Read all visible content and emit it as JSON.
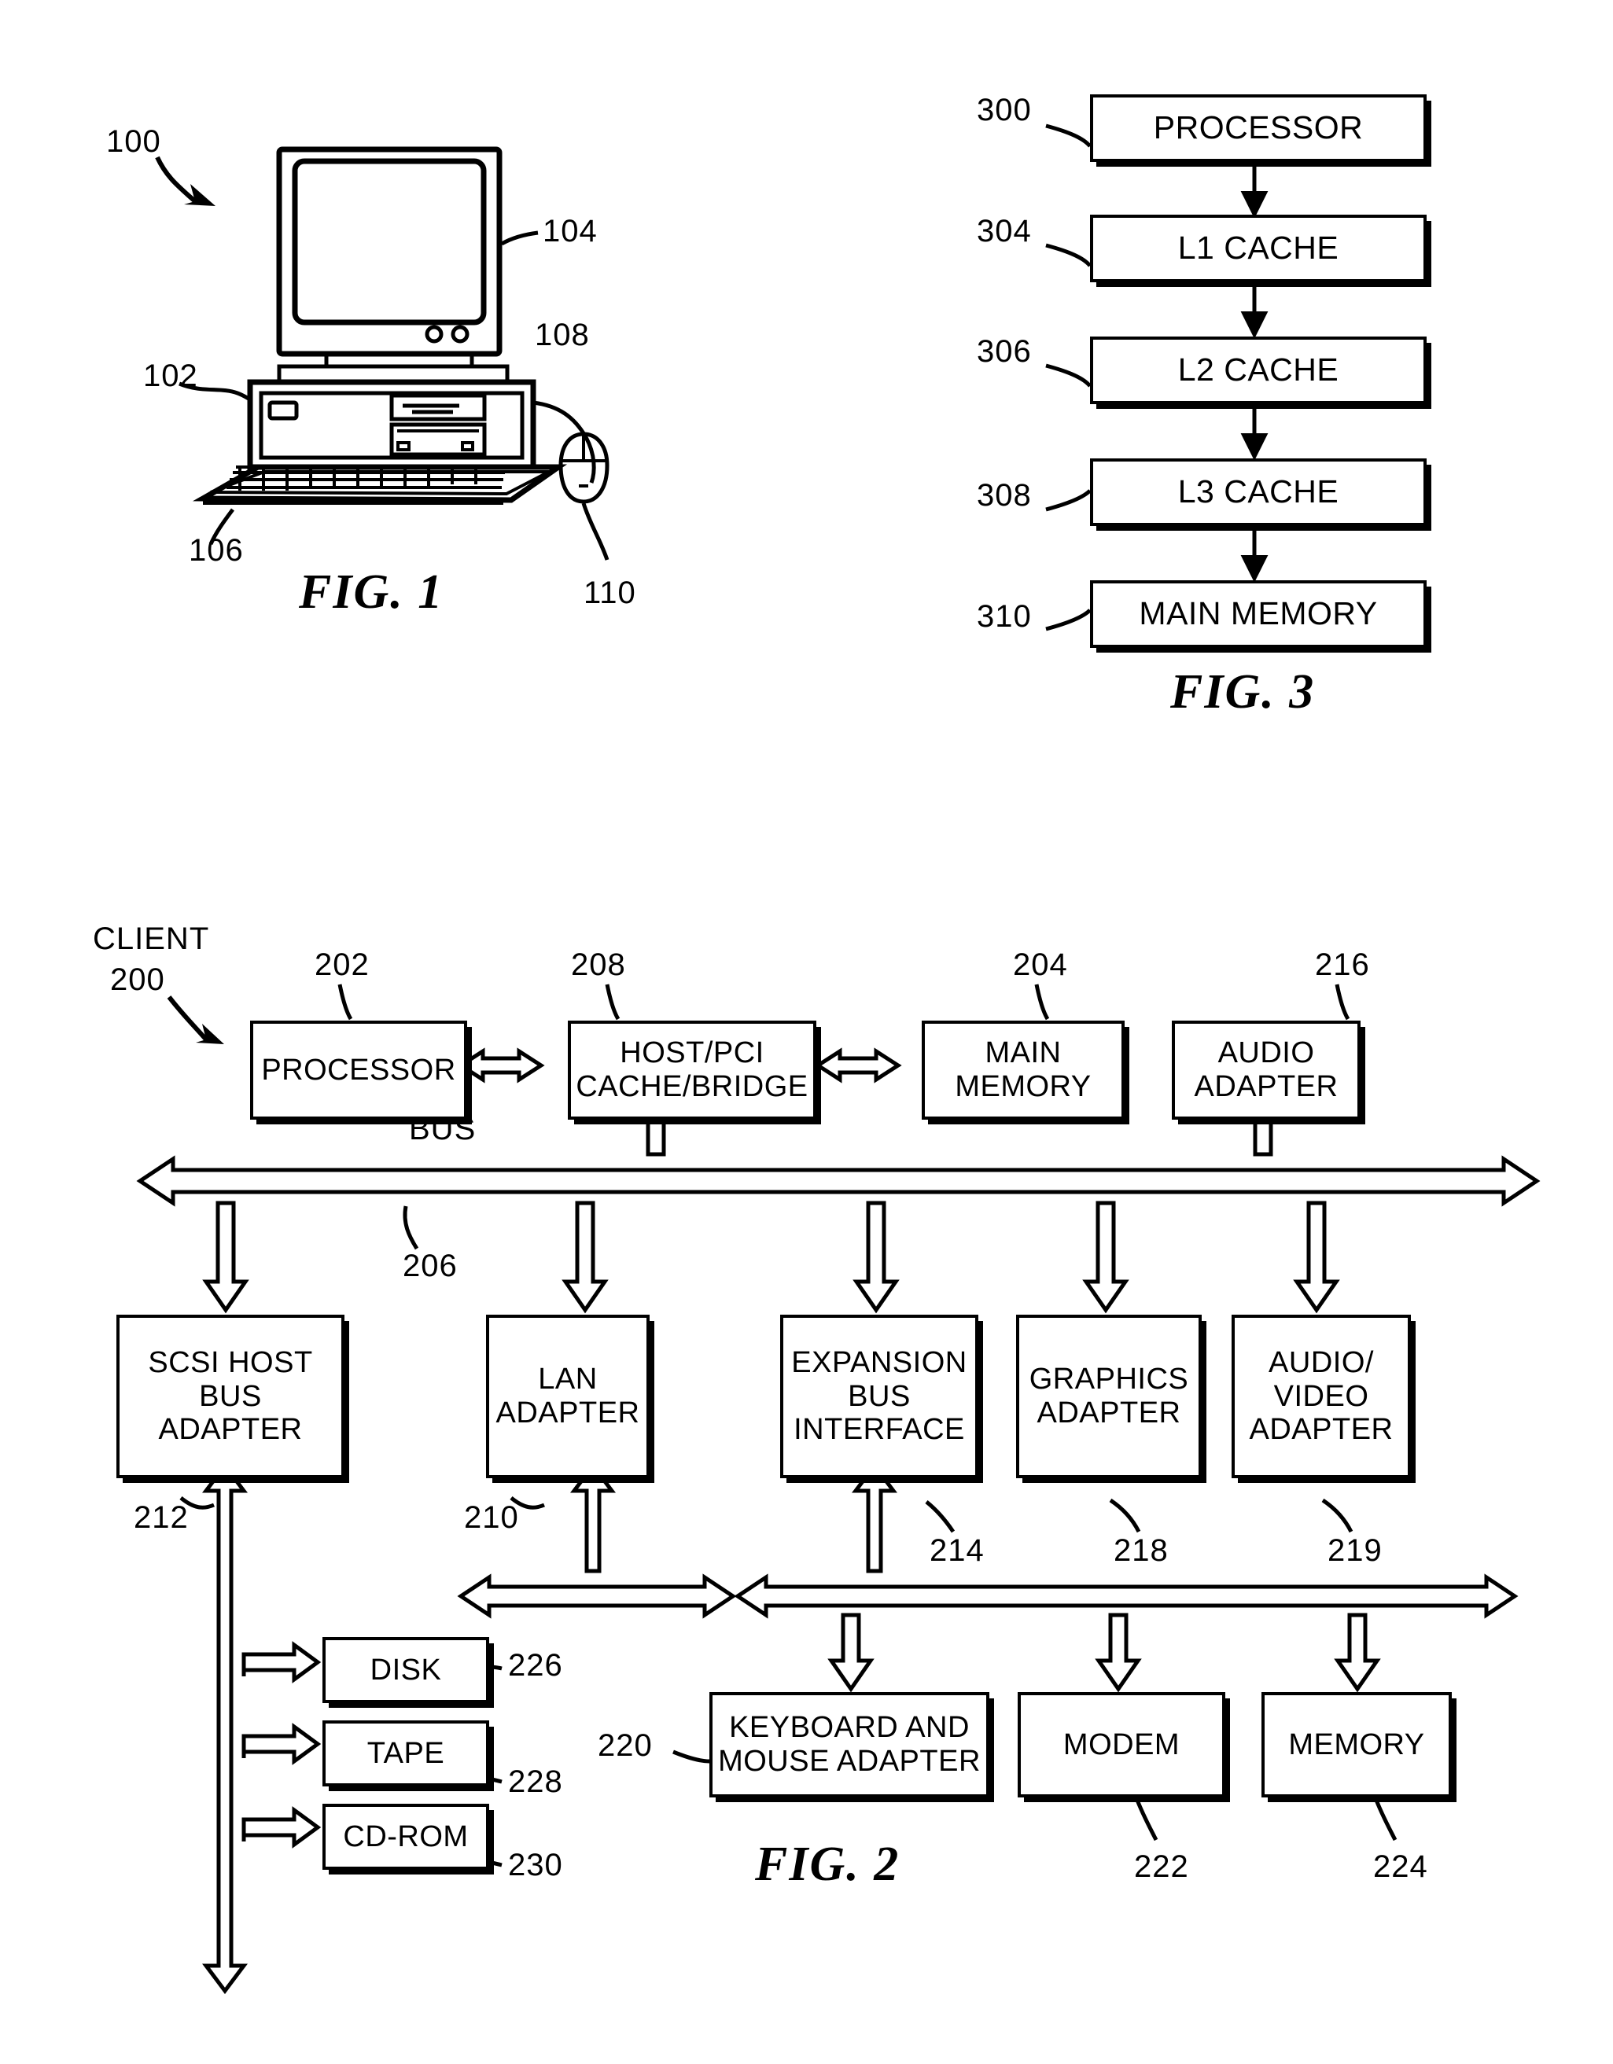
{
  "figure1": {
    "caption": "FIG. 1",
    "system_ref": "100",
    "refs": [
      {
        "id": "100",
        "target": "computer-system"
      },
      {
        "id": "102",
        "target": "system-unit"
      },
      {
        "id": "104",
        "target": "display-monitor"
      },
      {
        "id": "106",
        "target": "keyboard"
      },
      {
        "id": "108",
        "target": "floppy-drive"
      },
      {
        "id": "110",
        "target": "mouse"
      }
    ]
  },
  "figure3": {
    "caption": "FIG. 3",
    "type": "vertical-flow",
    "nodes": [
      {
        "ref": "300",
        "label": "PROCESSOR"
      },
      {
        "ref": "304",
        "label": "L1 CACHE"
      },
      {
        "ref": "306",
        "label": "L2 CACHE"
      },
      {
        "ref": "308",
        "label": "L3 CACHE"
      },
      {
        "ref": "310",
        "label": "MAIN MEMORY"
      }
    ],
    "edges": [
      {
        "from": "PROCESSOR",
        "to": "L1 CACHE"
      },
      {
        "from": "L1 CACHE",
        "to": "L2 CACHE"
      },
      {
        "from": "L2 CACHE",
        "to": "L3 CACHE"
      },
      {
        "from": "L3 CACHE",
        "to": "MAIN MEMORY"
      }
    ]
  },
  "figure2": {
    "caption": "FIG. 2",
    "system_title": "CLIENT",
    "system_ref": "200",
    "bus_label": "BUS",
    "bus_ref": "206",
    "row_top": [
      {
        "ref": "202",
        "label": "PROCESSOR"
      },
      {
        "ref": "208",
        "label": "HOST/PCI\nCACHE/BRIDGE",
        "line1": "HOST/PCI",
        "line2": "CACHE/BRIDGE"
      },
      {
        "ref": "204",
        "label": "MAIN\nMEMORY",
        "line1": "MAIN",
        "line2": "MEMORY"
      },
      {
        "ref": "216",
        "label": "AUDIO\nADAPTER",
        "line1": "AUDIO",
        "line2": "ADAPTER"
      }
    ],
    "row_adapters": [
      {
        "ref": "212",
        "label": "SCSI HOST\nBUS ADAPTER",
        "line1": "SCSI HOST",
        "line2": "BUS ADAPTER"
      },
      {
        "ref": "210",
        "label": "LAN\nADAPTER",
        "line1": "LAN",
        "line2": "ADAPTER"
      },
      {
        "ref": "214",
        "label": "EXPANSION\nBUS\nINTERFACE",
        "line1": "EXPANSION",
        "line2": "BUS",
        "line3": "INTERFACE"
      },
      {
        "ref": "218",
        "label": "GRAPHICS\nADAPTER",
        "line1": "GRAPHICS",
        "line2": "ADAPTER"
      },
      {
        "ref": "219",
        "label": "AUDIO/\nVIDEO\nADAPTER",
        "line1": "AUDIO/",
        "line2": "VIDEO",
        "line3": "ADAPTER"
      }
    ],
    "row_scsi_devices": [
      {
        "ref": "226",
        "label": "DISK"
      },
      {
        "ref": "228",
        "label": "TAPE"
      },
      {
        "ref": "230",
        "label": "CD-ROM"
      }
    ],
    "row_expansion_devices": [
      {
        "ref": "220",
        "label": "KEYBOARD AND\nMOUSE ADAPTER",
        "line1": "KEYBOARD AND",
        "line2": "MOUSE ADAPTER"
      },
      {
        "ref": "222",
        "label": "MODEM"
      },
      {
        "ref": "224",
        "label": "MEMORY"
      }
    ]
  },
  "colors": {
    "ink": "#000000",
    "paper": "#ffffff"
  }
}
